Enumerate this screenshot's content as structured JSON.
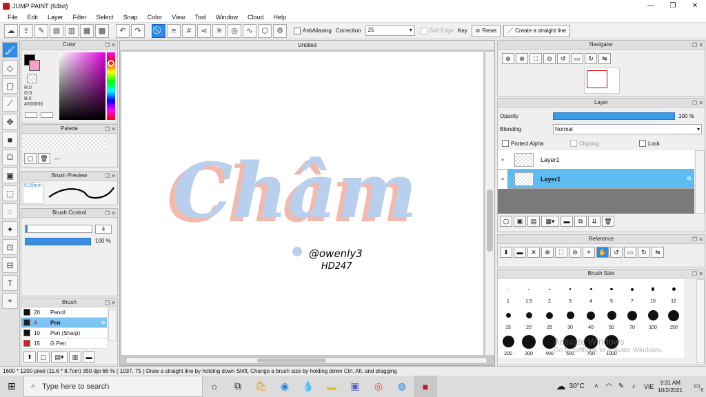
{
  "window": {
    "title": "JUMP PAINT (64bit)",
    "min": "—",
    "max": "❐",
    "close": "✕"
  },
  "menu": [
    "File",
    "Edit",
    "Layer",
    "Filter",
    "Select",
    "Snap",
    "Color",
    "View",
    "Tool",
    "Window",
    "Cloud",
    "Help"
  ],
  "toolbar": {
    "antialiasing": "AntiAliasing",
    "correction_label": "Correction",
    "correction_value": "25",
    "soft_edge": "Soft Edge",
    "key": "Key",
    "reset": "Reset",
    "straight_line": "Create a straight line"
  },
  "color_panel": {
    "title": "Color",
    "r": "R:0",
    "g": "G:0",
    "b": "B:0",
    "hex": "#000000"
  },
  "palette_panel": {
    "title": "Palette",
    "ellipsis": "---"
  },
  "brush_preview": {
    "title": "Brush Preview",
    "size": "0.29mm"
  },
  "brush_control": {
    "title": "Brush Control",
    "size_value": "4",
    "opacity_value": "100 %"
  },
  "brush_panel": {
    "title": "Brush",
    "items": [
      {
        "size": "20",
        "name": "Pencil",
        "color": "#111111"
      },
      {
        "size": "4",
        "name": "Pen",
        "color": "#222222",
        "selected": true
      },
      {
        "size": "10",
        "name": "Pen (Sharp)",
        "color": "#111111"
      },
      {
        "size": "15",
        "name": "G Pen",
        "color": "#e02020"
      }
    ]
  },
  "canvas": {
    "tab": "Untitled",
    "lettering": "Châm",
    "credit1": "@owenly3",
    "credit2": "HD247"
  },
  "navigator": {
    "title": "Navigator"
  },
  "layer_panel": {
    "title": "Layer",
    "opacity_label": "Opacity",
    "opacity_value": "100 %",
    "opacity": 1.0,
    "blending_label": "Blending",
    "blending_value": "Normal",
    "protect_alpha": "Protect Alpha",
    "clipping": "Clipping",
    "lock": "Lock",
    "layers": [
      {
        "name": "Layer1"
      },
      {
        "name": "Layer1",
        "selected": true
      }
    ]
  },
  "reference": {
    "title": "Reference"
  },
  "brush_size": {
    "title": "Brush Size",
    "sizes": [
      "1",
      "1.5",
      "2",
      "3",
      "4",
      "5",
      "7",
      "10",
      "12",
      "15",
      "20",
      "25",
      "30",
      "40",
      "50",
      "70",
      "100",
      "150",
      "200",
      "300",
      "400",
      "500",
      "700",
      "1000"
    ]
  },
  "watermark": {
    "line1": "Activate Windows",
    "line2": "Go to Settings to activate Windows."
  },
  "status": {
    "text": "1600 * 1200 pixel  (11.6 * 8.7cm)  350 dpi  66 %  ( 1037, 75 )  Draw a straight line by holding down Shift, Change a brush size by holding down Ctrl, Alt, and dragging"
  },
  "taskbar": {
    "search_placeholder": "Type here to search",
    "weather": "30°C",
    "lang": "VIE",
    "time": "9:31 AM",
    "date": "10/2/2021",
    "notif": "6"
  },
  "colors": {
    "accent": "#2f8be6",
    "lettering": "#b9cfee",
    "lettering_shadow": "#f4b9ad",
    "selected_row": "#7cc4f4"
  }
}
